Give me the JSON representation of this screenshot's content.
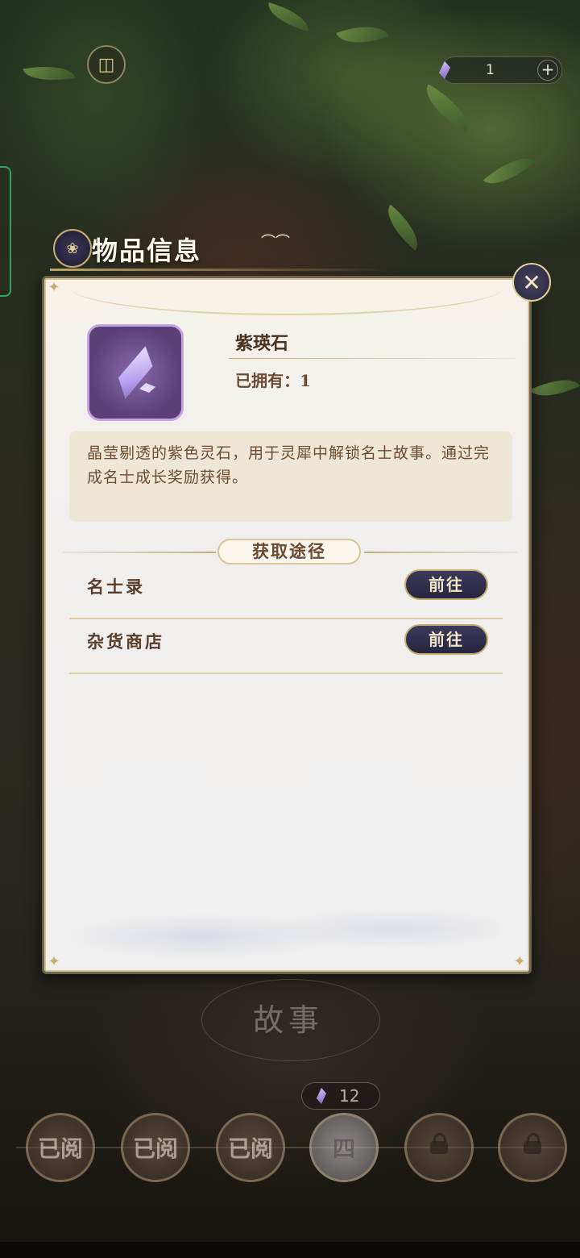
{
  "header": {
    "currency": {
      "icon": "purple-crystal-icon",
      "value": "1",
      "add_icon": "plus-icon"
    }
  },
  "dialog": {
    "title": "物品信息",
    "close_icon": "close-icon",
    "item": {
      "icon": "purple-crystal-icon",
      "name": "紫瑛石",
      "owned": "已拥有：1",
      "description": "晶莹剔透的紫色灵石，用于灵犀中解锁名士故事。通过完成名士成长奖励获得。"
    },
    "sources_title": "获取途径",
    "sources": [
      {
        "name": "名士录",
        "button": "前往"
      },
      {
        "name": "杂货商店",
        "button": "前往"
      }
    ]
  },
  "background": {
    "story_title": "故事",
    "crystal_count": "12",
    "chapters": [
      {
        "label": "已阅",
        "state": "read"
      },
      {
        "label": "已阅",
        "state": "read"
      },
      {
        "label": "已阅",
        "state": "read"
      },
      {
        "label": "四",
        "state": "current"
      },
      {
        "label": "",
        "state": "locked"
      },
      {
        "label": "",
        "state": "locked"
      }
    ]
  },
  "colors": {
    "panel_bg": "#f1efee",
    "text_brown": "#5a3c28",
    "button_navy": "#2f2e4b",
    "gold_border": "#c9ad70",
    "crystal_purple": "#8a6aa8"
  }
}
